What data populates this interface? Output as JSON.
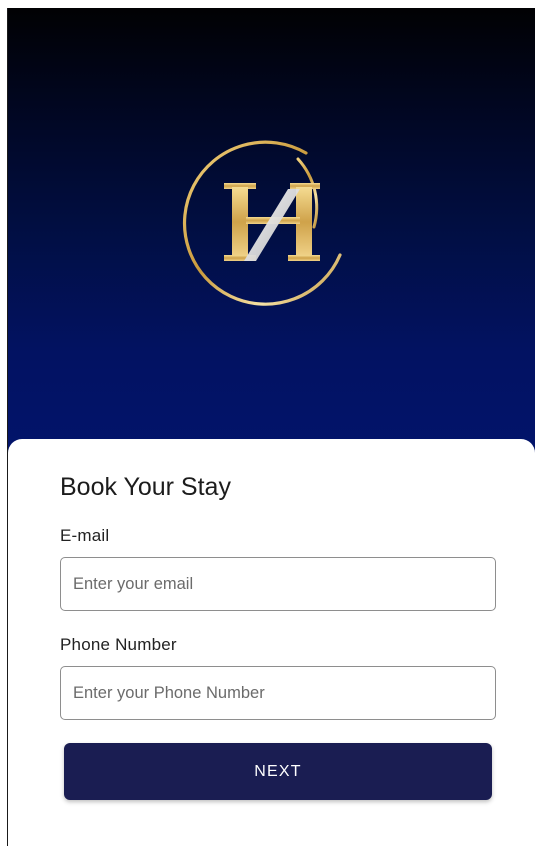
{
  "colors": {
    "hero_top": "#010103",
    "hero_bottom": "#02146c",
    "button_bg": "#1a1d52",
    "logo_gold": "#d9b25a"
  },
  "logo": {
    "icon": "hotel-h-monogram-logo"
  },
  "form": {
    "title": "Book Your Stay",
    "email": {
      "label": "E-mail",
      "placeholder": "Enter your email",
      "value": ""
    },
    "phone": {
      "label": "Phone Number",
      "placeholder": "Enter your Phone Number",
      "value": ""
    },
    "next_label": "NEXT"
  }
}
